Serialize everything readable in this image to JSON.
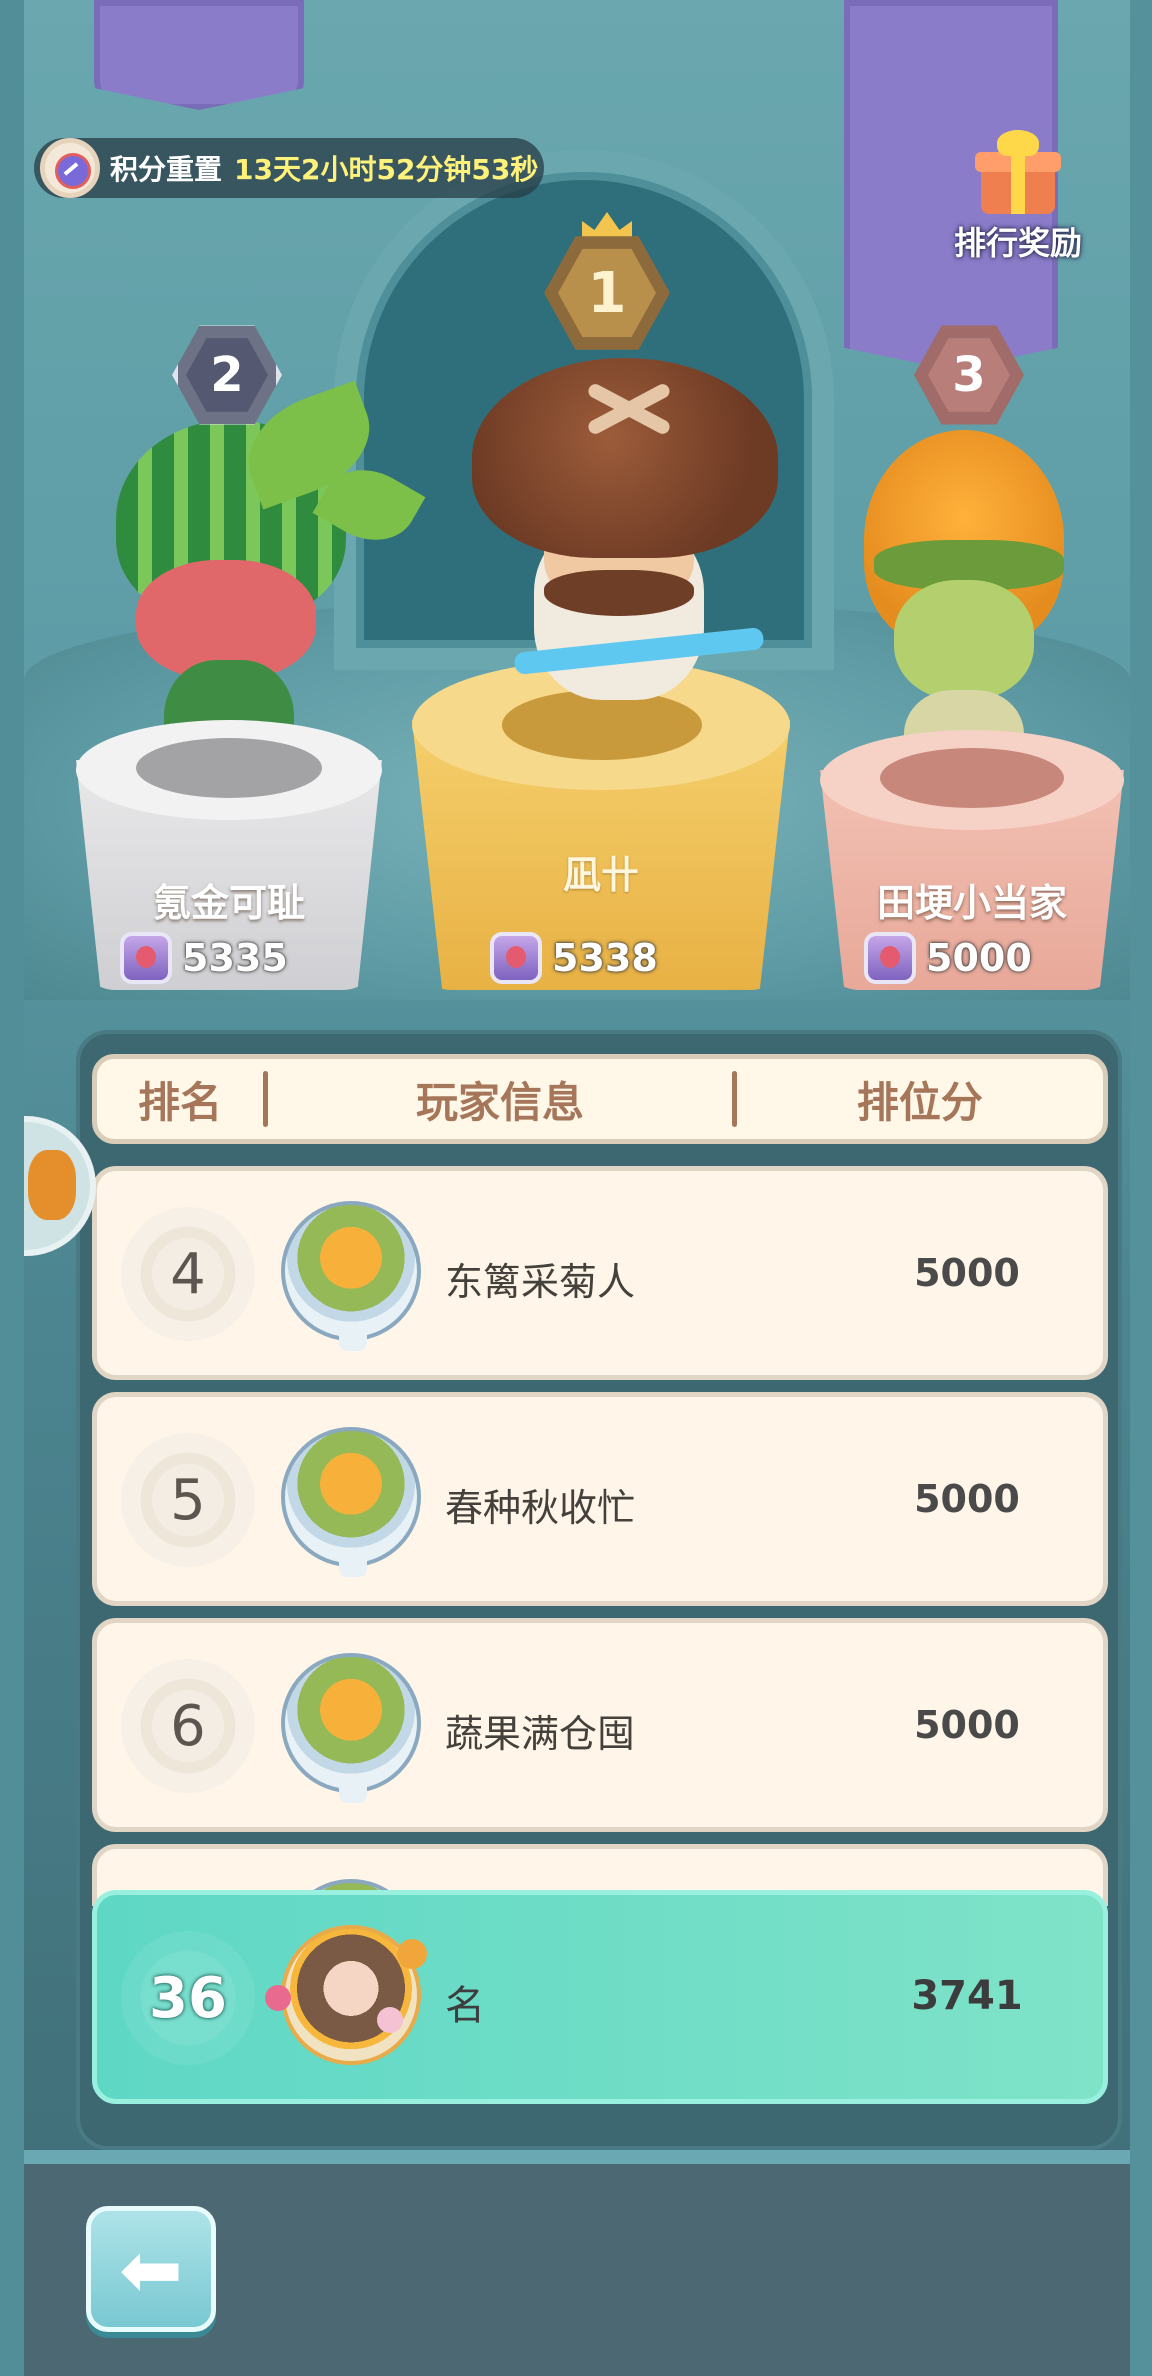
{
  "header": {
    "reset_label": "积分重置",
    "reset_time": "13天2小时52分钟53秒",
    "reward_label": "排行奖励"
  },
  "podium": [
    {
      "rank": "2",
      "name": "氪金可耻",
      "score": "5335",
      "color": "#e9e9ea"
    },
    {
      "rank": "1",
      "name": "凪卄",
      "score": "5338",
      "color": "#f5cf6c"
    },
    {
      "rank": "3",
      "name": "田埂小当家",
      "score": "5000",
      "color": "#f2c1b3"
    }
  ],
  "table": {
    "columns": [
      "排名",
      "玩家信息",
      "排位分"
    ],
    "rows": [
      {
        "rank": "4",
        "name": "东篱采菊人",
        "score": "5000"
      },
      {
        "rank": "5",
        "name": "春种秋收忙",
        "score": "5000"
      },
      {
        "rank": "6",
        "name": "蔬果满仓囤",
        "score": "5000"
      }
    ]
  },
  "me": {
    "rank": "36",
    "name": "名",
    "score": "3741"
  },
  "icons": {
    "reset": "clock-icon",
    "reward": "gift-icon",
    "back": "back-arrow-icon",
    "score_emblem": "rank-emblem-icon"
  },
  "colors": {
    "accent_purple": "#8b7cc9",
    "gold": "#f5cf6c",
    "highlight_row": "#6fdcc6",
    "header_text": "#a5765a"
  }
}
